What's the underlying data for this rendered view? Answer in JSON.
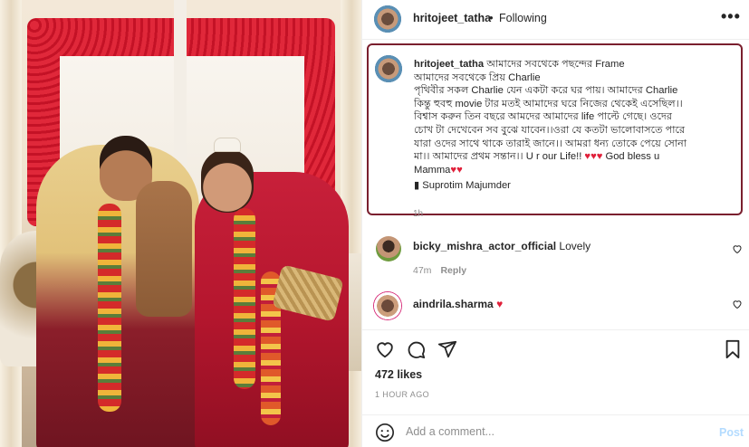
{
  "header": {
    "username": "hritojeet_tatha",
    "separator": "•",
    "follow_status": "Following"
  },
  "caption": {
    "username": "hritojeet_tatha",
    "lines": [
      "আমাদের সবথেকে পছন্দের Frame",
      "আমাদের সবথেকে প্রিয় Charlie",
      "পৃথিবীর সকল Charlie যেন একটা করে ঘর পায়। আমাদের Charlie",
      "কিন্তু হুবহু movie টার মতই আমাদের ঘরে নিজের থেকেই এসেছিল।।",
      "বিশ্বাস করুন তিন বছরে আমদের আমাদের life পাল্টে গেছে। ওদের",
      "চোখ টা দেখেবেন সব বুঝে যাবেন।।ওরা যে কতটা ভালোবাসতে পারে",
      "যারা ওদের সাথে থাকে তারাই জানে।। আমরা ধন্য তোকে পেয়ে সোনা",
      "মা।। আমাদের প্রথম সন্তান।। U r our Life!!"
    ],
    "line8_after_hearts": "God bless u",
    "line9": "Mamma",
    "credit": "Suprotim Majumder",
    "time": "1h"
  },
  "comments": [
    {
      "username": "bicky_mishra_actor_official",
      "text": "Lovely",
      "time": "47m",
      "reply_label": "Reply"
    },
    {
      "username": "aindrila.sharma",
      "text": ""
    }
  ],
  "post": {
    "likes": "472 likes",
    "posted_ago": "1 HOUR AGO"
  },
  "add_comment": {
    "placeholder": "Add a comment...",
    "post_label": "Post"
  },
  "icons": {
    "heart_color": "#e0203a",
    "border_highlight": "#7a1f2e",
    "post_button_color": "#b3dbff"
  }
}
